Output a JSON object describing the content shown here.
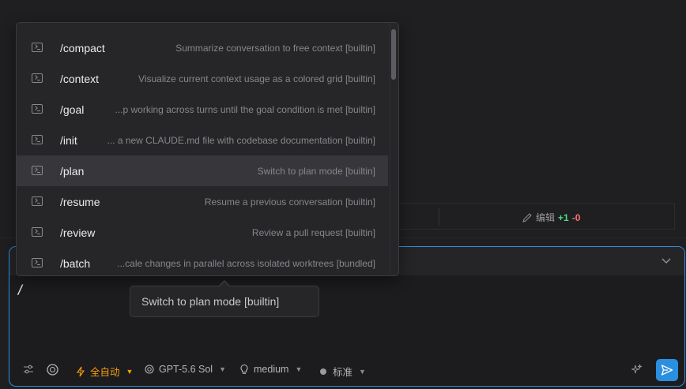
{
  "edit_row": {
    "label": "编辑",
    "added": "+1",
    "removed": "-0"
  },
  "popup": {
    "commands": [
      {
        "name": "/compact",
        "desc": "Summarize conversation to free context [builtin]",
        "selected": false
      },
      {
        "name": "/context",
        "desc": "Visualize current context usage as a colored grid [builtin]",
        "selected": false
      },
      {
        "name": "/goal",
        "desc": "...p working across turns until the goal condition is met [builtin]",
        "selected": false
      },
      {
        "name": "/init",
        "desc": "... a new CLAUDE.md file with codebase documentation [builtin]",
        "selected": false
      },
      {
        "name": "/plan",
        "desc": "Switch to plan mode [builtin]",
        "selected": true
      },
      {
        "name": "/resume",
        "desc": "Resume a previous conversation [builtin]",
        "selected": false
      },
      {
        "name": "/review",
        "desc": "Review a pull request [builtin]",
        "selected": false
      },
      {
        "name": "/batch",
        "desc": "...cale changes in parallel across isolated worktrees [bundled]",
        "selected": false
      }
    ]
  },
  "tooltip": {
    "text": "Switch to plan mode [builtin]"
  },
  "composer": {
    "input_value": "/",
    "toolbar": {
      "mode_label": "全自动",
      "model_label": "GPT-5.6 Sol",
      "effort_label": "medium",
      "style_label": "标准"
    }
  },
  "colors": {
    "accent": "#2b8fe0",
    "auto_mode": "#f59e0b",
    "added": "#4ade80",
    "removed": "#f87171"
  },
  "icons": [
    "terminal-icon",
    "pencil-icon",
    "sliders-icon",
    "openai-icon",
    "lightning-icon",
    "bulb-icon",
    "dot-icon",
    "sparkle-icon",
    "send-icon",
    "chevron-down-icon"
  ]
}
